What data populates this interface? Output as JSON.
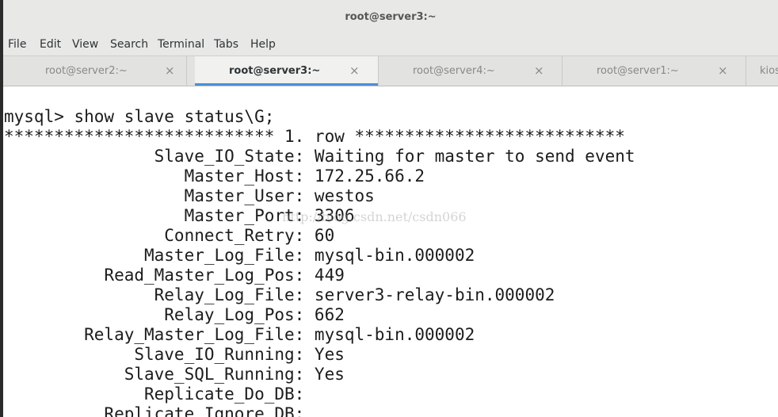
{
  "window": {
    "title": "root@server3:~"
  },
  "menubar": {
    "items": [
      "File",
      "Edit",
      "View",
      "Search",
      "Terminal",
      "Tabs",
      "Help"
    ]
  },
  "tabs": [
    {
      "label": "root@server2:~",
      "close": "×",
      "active": false
    },
    {
      "label": "root@server3:~",
      "close": "×",
      "active": true
    },
    {
      "label": "root@server4:~",
      "close": "×",
      "active": false
    },
    {
      "label": "root@server1:~",
      "close": "×",
      "active": false
    },
    {
      "label": "kios",
      "close": "",
      "active": false
    }
  ],
  "terminal": {
    "lines": [
      "mysql> show slave status\\G;",
      "*************************** 1. row ***************************",
      "               Slave_IO_State: Waiting for master to send event",
      "                  Master_Host: 172.25.66.2",
      "                  Master_User: westos",
      "                  Master_Port: 3306",
      "                Connect_Retry: 60",
      "              Master_Log_File: mysql-bin.000002",
      "          Read_Master_Log_Pos: 449",
      "               Relay_Log_File: server3-relay-bin.000002",
      "                Relay_Log_Pos: 662",
      "        Relay_Master_Log_File: mysql-bin.000002",
      "             Slave_IO_Running: Yes",
      "            Slave_SQL_Running: Yes",
      "              Replicate_Do_DB:",
      "          Replicate_Ignore_DB:"
    ],
    "watermark": "http://blog.csdn.net/csdn066"
  },
  "colors": {
    "accent": "#4a90d9",
    "chrome": "#e8e8e7",
    "text": "#1c1c1c"
  }
}
